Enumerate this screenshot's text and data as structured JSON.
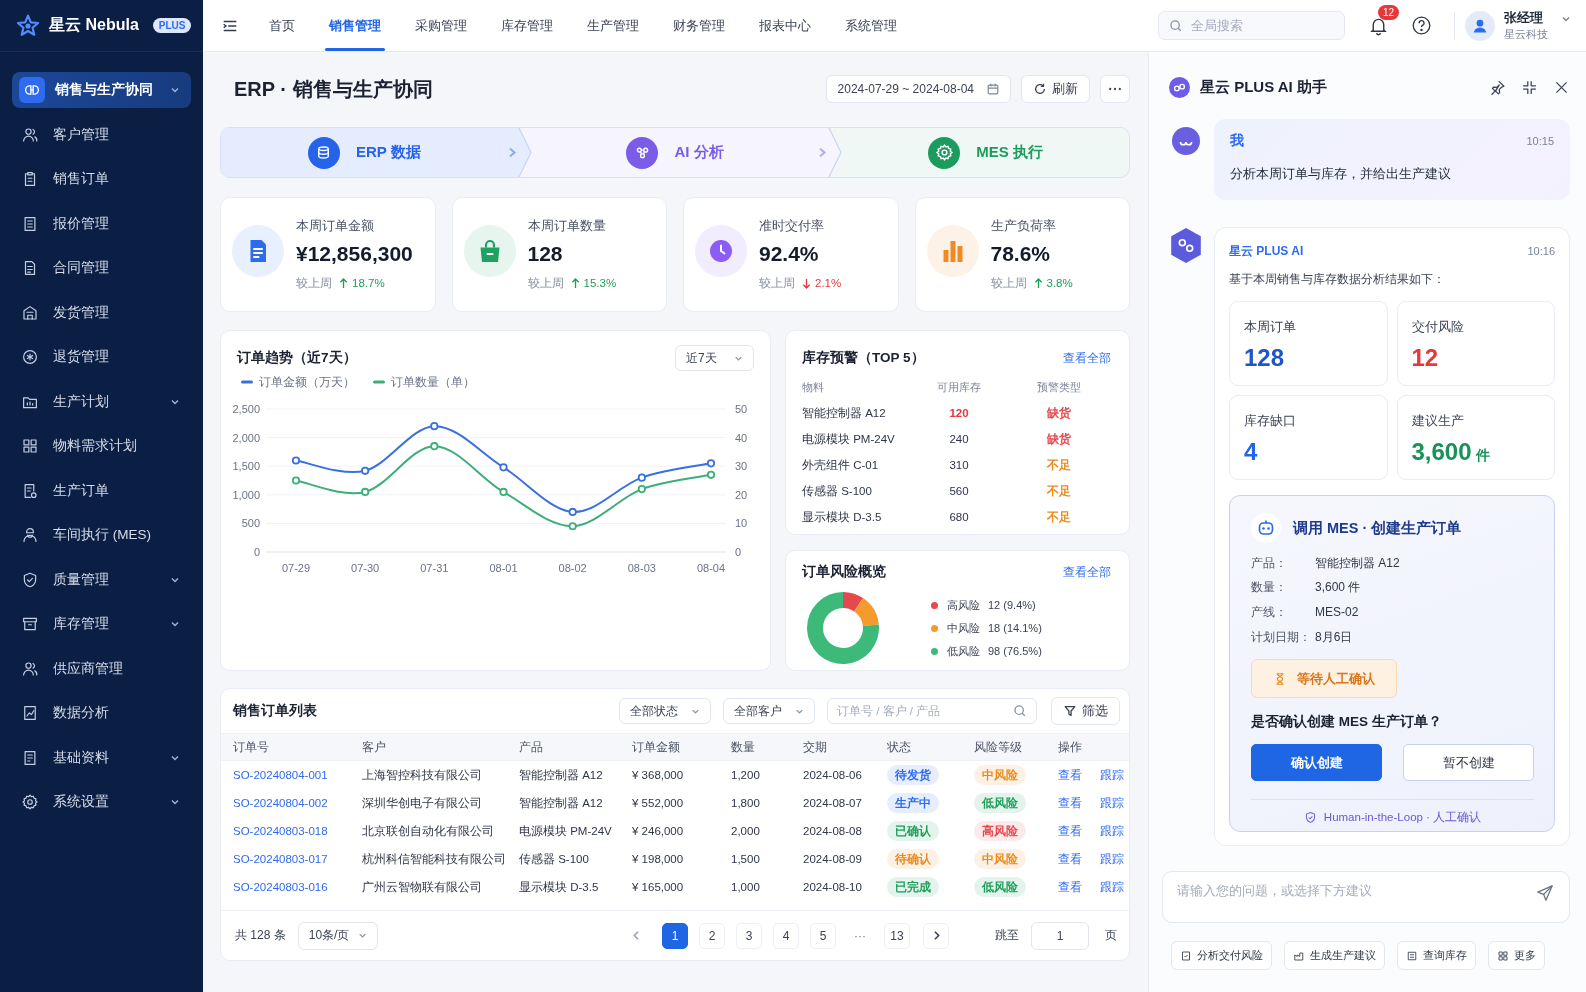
{
  "brand": {
    "name": "星云 Nebula",
    "badge": "PLUS"
  },
  "sidebar": {
    "items": [
      {
        "label": "销售与生产协同",
        "selected": true,
        "has_submenu": true
      },
      {
        "label": "客户管理",
        "selected": false,
        "has_submenu": false
      },
      {
        "label": "销售订单",
        "selected": false,
        "has_submenu": false
      },
      {
        "label": "报价管理",
        "selected": false,
        "has_submenu": false
      },
      {
        "label": "合同管理",
        "selected": false,
        "has_submenu": false
      },
      {
        "label": "发货管理",
        "selected": false,
        "has_submenu": false
      },
      {
        "label": "退货管理",
        "selected": false,
        "has_submenu": false
      },
      {
        "label": "生产计划",
        "selected": false,
        "has_submenu": true
      },
      {
        "label": "物料需求计划",
        "selected": false,
        "has_submenu": false
      },
      {
        "label": "生产订单",
        "selected": false,
        "has_submenu": false
      },
      {
        "label": "车间执行 (MES)",
        "selected": false,
        "has_submenu": false
      },
      {
        "label": "质量管理",
        "selected": false,
        "has_submenu": true
      },
      {
        "label": "库存管理",
        "selected": false,
        "has_submenu": true
      },
      {
        "label": "供应商管理",
        "selected": false,
        "has_submenu": false
      },
      {
        "label": "数据分析",
        "selected": false,
        "has_submenu": false
      },
      {
        "label": "基础资料",
        "selected": false,
        "has_submenu": true
      },
      {
        "label": "系统设置",
        "selected": false,
        "has_submenu": true
      }
    ]
  },
  "topbar": {
    "tabs": [
      {
        "label": "首页",
        "selected": false
      },
      {
        "label": "销售管理",
        "selected": true
      },
      {
        "label": "采购管理",
        "selected": false
      },
      {
        "label": "库存管理",
        "selected": false
      },
      {
        "label": "生产管理",
        "selected": false
      },
      {
        "label": "财务管理",
        "selected": false
      },
      {
        "label": "报表中心",
        "selected": false
      },
      {
        "label": "系统管理",
        "selected": false
      }
    ],
    "search": {
      "placeholder": "全局搜索"
    },
    "notifications": {
      "count": "12"
    },
    "user": {
      "name": "张经理",
      "company": "星云科技"
    }
  },
  "page": {
    "title": "ERP · 销售与生产协同",
    "date_range": "2024-07-29 ~ 2024-08-04",
    "refresh_button": "刷新"
  },
  "pipeline": [
    {
      "label": "ERP 数据",
      "color": "#2563eb"
    },
    {
      "label": "AI 分析",
      "color": "#7b5ce8"
    },
    {
      "label": "MES 执行",
      "color": "#1c9b5e"
    }
  ],
  "kpis": [
    {
      "label": "本周订单金额",
      "value": "¥12,856,300",
      "compare_label": "较上周",
      "change": "18.7%",
      "rising": true,
      "color": "#2f6bef"
    },
    {
      "label": "本周订单数量",
      "value": "128",
      "compare_label": "较上周",
      "change": "15.3%",
      "rising": true,
      "color": "#1fa163"
    },
    {
      "label": "准时交付率",
      "value": "92.4%",
      "compare_label": "较上周",
      "change": "2.1%",
      "rising": false,
      "color": "#8b5cf6"
    },
    {
      "label": "生产负荷率",
      "value": "78.6%",
      "compare_label": "较上周",
      "change": "3.8%",
      "rising": true,
      "color": "#f08a24"
    }
  ],
  "trend_card": {
    "range_select": "近7天",
    "chart_data": {
      "type": "line",
      "title": "订单趋势（近7天）",
      "categories": [
        "07-29",
        "07-30",
        "07-31",
        "08-01",
        "08-02",
        "08-03",
        "08-04"
      ],
      "series": [
        {
          "name": "订单金额（万天）",
          "color": "#3a6fe0",
          "marker": true,
          "values": [
            1600,
            1420,
            2200,
            1480,
            700,
            1300,
            1550
          ]
        },
        {
          "name": "订单数量（单）",
          "color": "#3dae7a",
          "axis": "y2",
          "marker": true,
          "values": [
            25,
            21,
            37,
            21,
            9,
            22,
            27
          ]
        }
      ],
      "grid": true,
      "ylim": [
        0,
        2500
      ],
      "yticks": [
        0,
        500,
        {
          "value": 1000,
          "label": "1,000"
        },
        {
          "value": 1500,
          "label": "1,500"
        },
        {
          "value": 2000,
          "label": "2,000"
        },
        {
          "value": 2500,
          "label": "2,500"
        }
      ],
      "y2lim": [
        0,
        50
      ],
      "y2ticks": [
        0,
        10,
        20,
        30,
        40,
        50
      ]
    }
  },
  "inventory_card": {
    "title": "库存预警（TOP 5）",
    "link": "查看全部",
    "columns": [
      "物料",
      "可用库存",
      "预警类型"
    ],
    "rows": [
      {
        "material": "智能控制器 A12",
        "stock": "120",
        "stock_alert": true,
        "warning": {
          "label": "缺货",
          "color": "#e5484d"
        }
      },
      {
        "material": "电源模块 PM-24V",
        "stock": "240",
        "stock_alert": false,
        "warning": {
          "label": "缺货",
          "color": "#e5484d"
        }
      },
      {
        "material": "外壳组件 C-01",
        "stock": "310",
        "stock_alert": false,
        "warning": {
          "label": "不足",
          "color": "#ea8a1c"
        }
      },
      {
        "material": "传感器 S-100",
        "stock": "560",
        "stock_alert": false,
        "warning": {
          "label": "不足",
          "color": "#ea8a1c"
        }
      },
      {
        "material": "显示模块 D-3.5",
        "stock": "680",
        "stock_alert": false,
        "warning": {
          "label": "不足",
          "color": "#ea8a1c"
        }
      }
    ]
  },
  "risk_card": {
    "link": "查看全部",
    "chart_data": {
      "type": "donut",
      "title": "订单风险概览",
      "categories": [
        "高风险",
        "中风险",
        "低风险"
      ],
      "values": [
        9.4,
        14.1,
        76.5
      ],
      "colors": [
        "#e5484d",
        "#f59a2c",
        "#3dba7a"
      ],
      "value_labels": [
        "12 (9.4%)",
        "18 (14.1%)",
        "98 (76.5%)"
      ]
    }
  },
  "orders_table": {
    "title": "销售订单列表",
    "filters": [
      "全部状态",
      "全部客户"
    ],
    "search": {
      "placeholder": "订单号 / 客户 / 产品"
    },
    "filter_button": "筛选",
    "columns": [
      "订单号",
      "客户",
      "产品",
      "订单金额",
      "数量",
      "交期",
      "状态",
      "风险等级",
      "操作"
    ],
    "rows": [
      {
        "order_no": "SO-20240804-001",
        "customer": "上海智控科技有限公司",
        "product": "智能控制器 A12",
        "amount": "¥ 368,000",
        "quantity": "1,200",
        "due_date": "2024-08-06",
        "status": {
          "label": "待发货",
          "color": "#2f6bef"
        },
        "risk": {
          "label": "中风险",
          "color": "#ea8a1c"
        },
        "actions": [
          "查看",
          "跟踪"
        ]
      },
      {
        "order_no": "SO-20240804-002",
        "customer": "深圳华创电子有限公司",
        "product": "智能控制器 A12",
        "amount": "¥ 552,000",
        "quantity": "1,800",
        "due_date": "2024-08-07",
        "status": {
          "label": "生产中",
          "color": "#2f6bef"
        },
        "risk": {
          "label": "低风险",
          "color": "#1e9e5a"
        },
        "actions": [
          "查看",
          "跟踪"
        ]
      },
      {
        "order_no": "SO-20240803-018",
        "customer": "北京联创自动化有限公司",
        "product": "电源模块 PM-24V",
        "amount": "¥ 246,000",
        "quantity": "2,000",
        "due_date": "2024-08-08",
        "status": {
          "label": "已确认",
          "color": "#1e9e5a"
        },
        "risk": {
          "label": "高风险",
          "color": "#e5484d"
        },
        "actions": [
          "查看",
          "跟踪"
        ]
      },
      {
        "order_no": "SO-20240803-017",
        "customer": "杭州科信智能科技有限公司",
        "product": "传感器 S-100",
        "amount": "¥ 198,000",
        "quantity": "1,500",
        "due_date": "2024-08-09",
        "status": {
          "label": "待确认",
          "color": "#ea8a1c"
        },
        "risk": {
          "label": "中风险",
          "color": "#ea8a1c"
        },
        "actions": [
          "查看",
          "跟踪"
        ]
      },
      {
        "order_no": "SO-20240803-016",
        "customer": "广州云智物联有限公司",
        "product": "显示模块 D-3.5",
        "amount": "¥ 165,000",
        "quantity": "1,000",
        "due_date": "2024-08-10",
        "status": {
          "label": "已完成",
          "color": "#1e9e5a"
        },
        "risk": {
          "label": "低风险",
          "color": "#1e9e5a"
        },
        "actions": [
          "查看",
          "跟踪"
        ]
      }
    ],
    "pagination": {
      "total": "共 128 条",
      "page_size": "10条/页",
      "pages": [
        {
          "label": "1",
          "kind": "page",
          "selected": true
        },
        {
          "label": "2",
          "kind": "page",
          "selected": false
        },
        {
          "label": "3",
          "kind": "page",
          "selected": false
        },
        {
          "label": "4",
          "kind": "page",
          "selected": false
        },
        {
          "label": "5",
          "kind": "page",
          "selected": false
        },
        {
          "label": "···",
          "kind": "ellipsis",
          "selected": false
        },
        {
          "label": "13",
          "kind": "page",
          "selected": false
        }
      ],
      "jump_label": "跳至",
      "jump_value": "1",
      "jump_unit": "页"
    }
  },
  "assistant": {
    "title": "星云 PLUS AI 助手",
    "messages": [
      {
        "kind": "user",
        "sender": "我",
        "time": "10:15",
        "text": "分析本周订单与库存，并给出生产建议"
      },
      {
        "kind": "ai",
        "sender": "星云 PLUS AI",
        "time": "10:16",
        "text": "基于本周销售与库存数据分析结果如下：",
        "stats": [
          {
            "label": "本周订单",
            "value": "128",
            "color": "#1e55c9"
          },
          {
            "label": "交付风险",
            "value": "12",
            "color": "#e5383b"
          },
          {
            "label": "库存缺口",
            "value": "4",
            "color": "#2563eb"
          },
          {
            "label": "建议生产",
            "value": "3,600",
            "unit": "件",
            "color": "#16925a"
          }
        ],
        "action": {
          "title": "调用 MES · 创建生产订单",
          "fields": [
            {
              "label": "产品：",
              "value": "智能控制器 A12"
            },
            {
              "label": "数量：",
              "value": "3,600 件"
            },
            {
              "label": "产线：",
              "value": "MES-02"
            },
            {
              "label": "计划日期：",
              "value": "8月6日"
            }
          ],
          "status": "等待人工确认",
          "question": "是否确认创建 MES 生产订单？",
          "buttons": [
            {
              "label": "确认创建",
              "kind": "primary"
            },
            {
              "label": "暂不创建",
              "kind": "secondary"
            }
          ],
          "footer": "Human-in-the-Loop · 人工确认"
        }
      }
    ],
    "input": {
      "placeholder": "请输入您的问题，或选择下方建议"
    },
    "suggestions": [
      "分析交付风险",
      "生成生产建议",
      "查询库存",
      "更多"
    ]
  }
}
